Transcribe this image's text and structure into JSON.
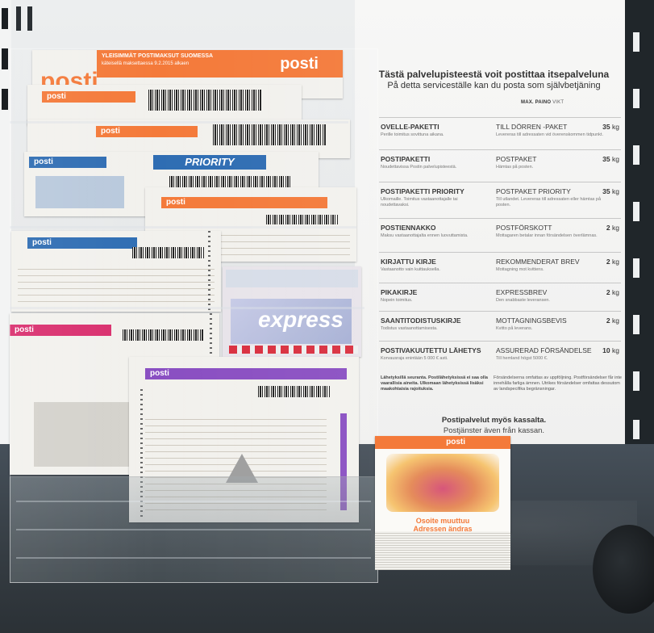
{
  "sign": {
    "title_fi": "Tästä palvelupisteestä voit postittaa itsepalveluna",
    "title_sv": "På detta serviceställe kan du posta som självbetjäning",
    "max_label": "MAX. PAINO",
    "max_label_sv": "VIKT",
    "items": [
      {
        "fi": "OVELLE-PAKETTI",
        "fi_desc": "Perille toimitus sovittuna aikana.",
        "sv": "TILL DÖRREN -PAKET",
        "sv_desc": "Levereras till adressaten vid överenskommen tidpunkt.",
        "weight": "35",
        "unit": "kg"
      },
      {
        "fi": "POSTIPAKETTI",
        "fi_desc": "Noudettavissa Postin palvelupisteestä.",
        "sv": "POSTPAKET",
        "sv_desc": "Hämtas på posten.",
        "weight": "35",
        "unit": "kg"
      },
      {
        "fi": "POSTIPAKETTI PRIORITY",
        "fi_desc": "Ulkomaille. Toimitus vastaanottajalle tai noudettavaksi.",
        "sv": "POSTPAKET PRIORITY",
        "sv_desc": "Till utlandet. Levereras till adressaten eller hämtas på posten.",
        "weight": "35",
        "unit": "kg"
      },
      {
        "fi": "POSTIENNAKKO",
        "fi_desc": "Maksu vastaanottajalta ennen luovuttamista.",
        "sv": "POSTFÖRSKOTT",
        "sv_desc": "Mottagaren betalar innan försändelsen överlämnas.",
        "weight": "2",
        "unit": "kg"
      },
      {
        "fi": "KIRJATTU KIRJE",
        "fi_desc": "Vastaanotto vain kuittauksella.",
        "sv": "REKOMMENDERAT BREV",
        "sv_desc": "Mottagning mot kvittens.",
        "weight": "2",
        "unit": "kg"
      },
      {
        "fi": "PIKAKIRJE",
        "fi_desc": "Nopein toimitus.",
        "sv": "EXPRESSBREV",
        "sv_desc": "Den snabbaste leveransen.",
        "weight": "2",
        "unit": "kg"
      },
      {
        "fi": "SAANTITODISTUSKIRJE",
        "fi_desc": "Todistus vastaanottamisesta.",
        "sv": "MOTTAGNINGSBEVIS",
        "sv_desc": "Kvitto på leverans.",
        "weight": "2",
        "unit": "kg"
      },
      {
        "fi": "POSTIVAKUUTETTU LÄHETYS",
        "fi_desc": "Korvausraja enintään 5 000 € asti.",
        "sv": "ASSURERAD FÖRSÄNDELSE",
        "sv_desc": "Till hemland högst 5000 €.",
        "weight": "10",
        "unit": "kg"
      }
    ],
    "note_fi": "Lähetyksillä seuranta. Postilähetyksissä ei saa olla vaarallisia aineita. Ulkomaan lähetyksissä lisäksi maakohtaisia rajoituksia.",
    "note_sv": "Försändelserna omfattas av uppföljning. Postförsändelser får inte innehålla farliga ämnen. Utrikes försändelser omfattas dessutom av landspecifika begränsningar.",
    "footer_fi": "Postipalvelut myös kassalta.",
    "footer_sv": "Postjänster även från kassan."
  },
  "rack": {
    "top_banner_text_1": "YLEISIMMÄT POSTIMAKSUT SUOMESSA",
    "top_banner_text_2": "käteisellä maksettaessa 9.2.2015 alkaen",
    "brand": "posti",
    "priority": "PRIORITY",
    "express": "express"
  },
  "flyer": {
    "brand": "posti",
    "title_fi": "Osoite muuttuu",
    "title_sv": "Adressen ändras"
  },
  "colors": {
    "posti_orange": "#f47a3a",
    "posti_blue": "#2f6db3",
    "posti_pink": "#d92f6e",
    "posti_purple": "#8a4fc2"
  }
}
